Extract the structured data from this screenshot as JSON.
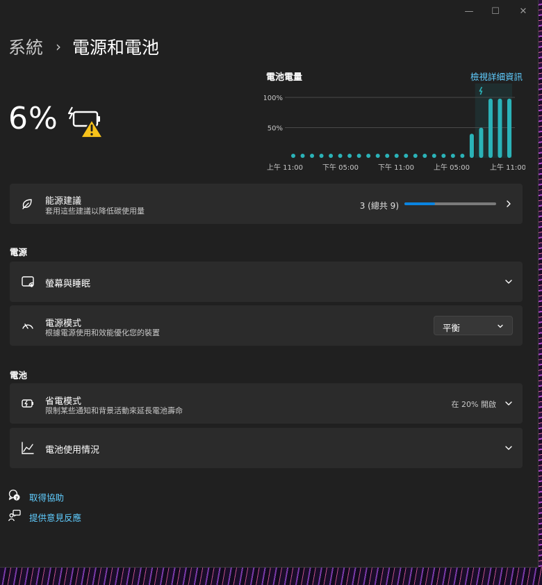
{
  "window": {
    "controls": {
      "minimize": "—",
      "maximize": "☐",
      "close": "✕"
    }
  },
  "breadcrumb": {
    "parent": "系統",
    "separator": "›",
    "current": "電源和電池"
  },
  "battery": {
    "percent_label": "6%",
    "level_percent": 6,
    "icon": "battery-charging-warning-icon"
  },
  "chart_data": {
    "type": "bar",
    "title": "電池電量",
    "link": "檢視詳細資訊",
    "y_ticks": [
      "100%",
      "50%"
    ],
    "ylim": [
      0,
      100
    ],
    "x_ticks": [
      "上午 11:00",
      "下午 05:00",
      "下午 11:00",
      "上午 05:00",
      "上午 11:00"
    ],
    "values": [
      0,
      0,
      0,
      0,
      0,
      0,
      0,
      0,
      0,
      0,
      0,
      0,
      0,
      0,
      0,
      0,
      0,
      0,
      0,
      40,
      50,
      98,
      98,
      98
    ],
    "charging_marker": "lightning-icon",
    "grid": true,
    "colors": {
      "bar": "#2bb3b8",
      "highlight": "#1f3a3c"
    }
  },
  "energy_card": {
    "title": "能源建議",
    "subtitle": "套用這些建議以降低碳使用量",
    "progress_text": "3 (總共 9)",
    "progress_done": 3,
    "progress_total": 9,
    "icon": "leaf-icon"
  },
  "sections": {
    "power": "電源",
    "battery": "電池"
  },
  "screen_sleep": {
    "title": "螢幕與睡眠",
    "icon": "screen-sleep-icon"
  },
  "power_mode": {
    "title": "電源模式",
    "subtitle": "根據電源使用和效能優化您的裝置",
    "value": "平衡",
    "icon": "power-mode-gauge-icon"
  },
  "battery_saver": {
    "title": "省電模式",
    "subtitle": "限制某些通知和背景活動來延長電池壽命",
    "status": "在 20% 開啟",
    "icon": "battery-saver-icon"
  },
  "battery_usage": {
    "title": "電池使用情況",
    "icon": "chart-line-icon"
  },
  "links": {
    "help": "取得協助",
    "feedback": "提供意見反應"
  },
  "colors": {
    "accent": "#60cdff",
    "card": "#2b2b2b",
    "window": "#202020",
    "progress": "#0a84e0"
  }
}
